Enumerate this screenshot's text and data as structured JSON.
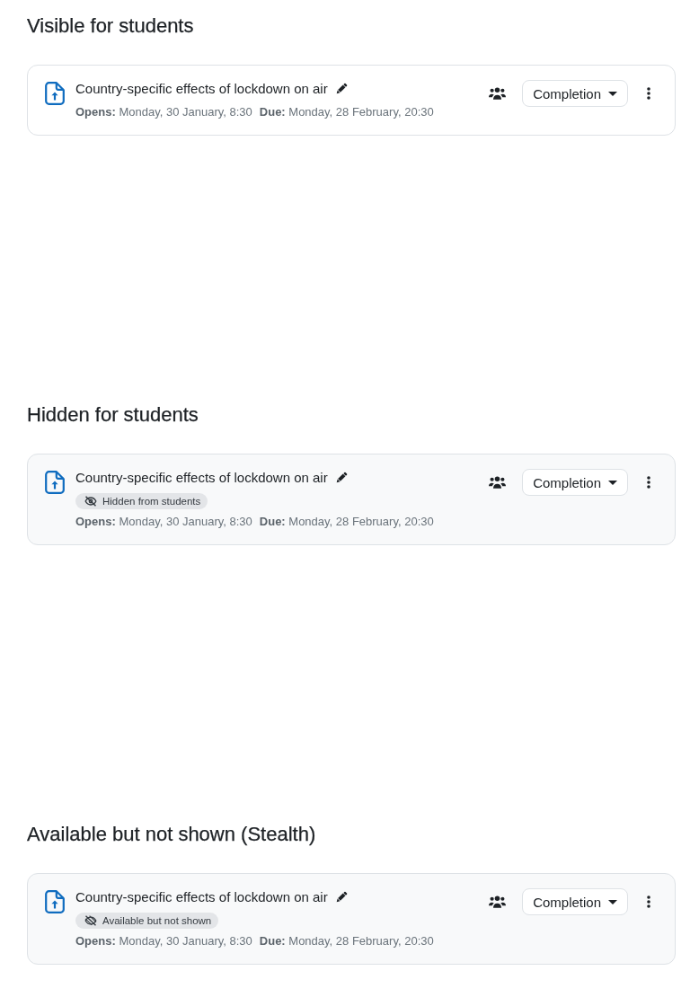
{
  "sections": [
    {
      "heading": "Visible for students",
      "activity": {
        "kind": "visible",
        "title": "Country-specific effects of lockdown on air",
        "dates": [
          "**Opens:** Monday, 30 January, 8:30",
          "**Due:** Monday, 28 February, 20:30"
        ],
        "completion_button": "Completion"
      }
    },
    {
      "heading": "Hidden for students",
      "activity": {
        "kind": "hidden",
        "title": "Country-specific effects of lockdown on air",
        "badge": "Hidden from students",
        "dates": [
          "**Opens:** Monday, 30 January, 8:30",
          "**Due:** Monday, 28 February, 20:30"
        ],
        "completion_button": "Completion"
      }
    },
    {
      "heading": "Available but not shown (Stealth)",
      "activity": {
        "kind": "stealth",
        "title": "Country-specific effects of lockdown on air",
        "badge": "Available but not shown",
        "dates": [
          "**Opens:** Monday, 30 January, 8:30",
          "**Due:** Monday, 28 February, 20:30"
        ],
        "completion_button": "Completion"
      }
    }
  ]
}
